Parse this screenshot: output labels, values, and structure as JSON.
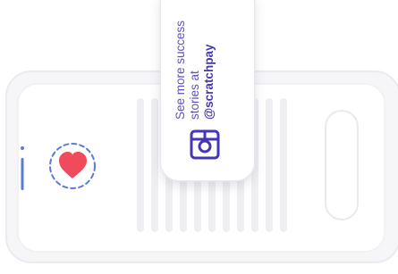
{
  "callout": {
    "line1": "See more success",
    "line2": "stories at",
    "handle": "@scratchpay"
  },
  "icons": {
    "heart": "heart-icon",
    "social": "instagram-icon"
  },
  "colors": {
    "accent": "#5a4fc7",
    "heart": "#ef4b5b",
    "rays": "#5b7bd6",
    "phone_outline": "#ececf2"
  }
}
